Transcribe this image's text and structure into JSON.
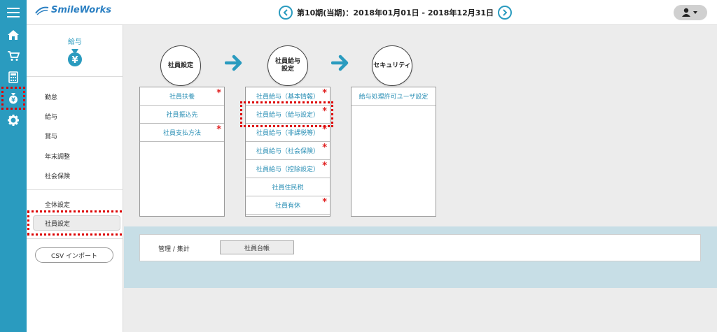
{
  "header": {
    "brand": "SmileWorks",
    "period": "第10期(当期)：2018年01月01日 - 2018年12月31日"
  },
  "sidebar": {
    "section_title": "給与",
    "items": [
      "勤怠",
      "給与",
      "賞与",
      "年末調整",
      "社会保険"
    ],
    "settings": [
      "全体設定",
      "社員設定"
    ],
    "csv_button": "CSV インポート"
  },
  "flow": [
    {
      "title": "社員設定",
      "rows": [
        {
          "label": "社員扶養",
          "required": "*"
        },
        {
          "label": "社員振込先",
          "required": ""
        },
        {
          "label": "社員支払方法",
          "required": "*"
        }
      ]
    },
    {
      "title": "社員給与\n設定",
      "rows": [
        {
          "label": "社員給与（基本情報）",
          "required": "*"
        },
        {
          "label": "社員給与（給与設定）",
          "required": "*"
        },
        {
          "label": "社員給与（非課税等）",
          "required": "*"
        },
        {
          "label": "社員給与（社会保険）",
          "required": "*"
        },
        {
          "label": "社員給与（控除設定）",
          "required": "*"
        },
        {
          "label": "社員住民税",
          "required": ""
        },
        {
          "label": "社員有休",
          "required": "*"
        }
      ]
    },
    {
      "title": "セキュリティ",
      "rows": [
        {
          "label": "給与処理許可ユーザ設定",
          "required": ""
        }
      ]
    }
  ],
  "management": {
    "label": "管理 / 集計",
    "button": "社員台帳"
  },
  "colors": {
    "rail": "#2a9bbf",
    "accent": "#2a9bbf",
    "highlight": "#dd0000",
    "required": "#e02020"
  },
  "icons": [
    "menu-icon",
    "home-icon",
    "cart-icon",
    "calculator-icon",
    "money-bag-icon",
    "gear-icon",
    "user-icon",
    "chevron-left-icon",
    "chevron-right-icon"
  ]
}
